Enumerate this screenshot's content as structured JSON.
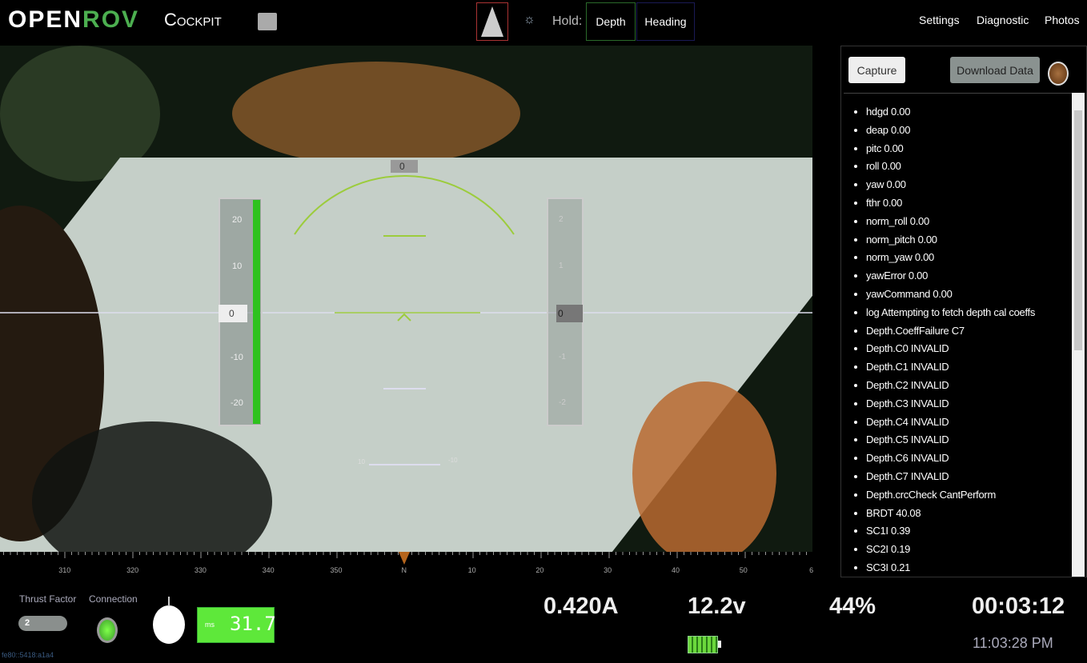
{
  "header": {
    "logo": "OPENROV",
    "logo_a": "OPEN",
    "logo_b": "ROV",
    "app": "Cockpit",
    "hold_label": "Hold:",
    "hold_depth": "Depth",
    "hold_heading": "Heading",
    "nav": [
      "Settings",
      "Diagnostic",
      "Photos"
    ]
  },
  "hud": {
    "heading_value": "0",
    "depth_value": "0",
    "pitch_value": "0",
    "depth_ticks": [
      "20",
      "10",
      "-10",
      "-20"
    ],
    "pitch_ticks": [
      "2",
      "1",
      "-1",
      "-2"
    ],
    "roll_left": "10",
    "roll_right": "-10"
  },
  "compass": {
    "labels": [
      "0",
      "310",
      "320",
      "330",
      "340",
      "350",
      "N",
      "10",
      "20",
      "30",
      "40",
      "50",
      "6"
    ]
  },
  "panel": {
    "capture": "Capture",
    "download": "Download Data",
    "log": [
      "hdgd 0.00",
      "deap 0.00",
      "pitc 0.00",
      "roll 0.00",
      "yaw 0.00",
      "fthr 0.00",
      "norm_roll 0.00",
      "norm_pitch 0.00",
      "norm_yaw 0.00",
      "yawError 0.00",
      "yawCommand 0.00",
      "log Attempting to fetch depth cal coeffs",
      "Depth.CoeffFailure C7",
      "Depth.C0 INVALID",
      "Depth.C1 INVALID",
      "Depth.C2 INVALID",
      "Depth.C3 INVALID",
      "Depth.C4 INVALID",
      "Depth.C5 INVALID",
      "Depth.C6 INVALID",
      "Depth.C7 INVALID",
      "Depth.crcCheck CantPerform",
      "BRDT 40.08",
      "SC1I 0.39",
      "SC2I 0.19",
      "SC3I 0.21"
    ]
  },
  "status": {
    "thrust_label": "Thrust Factor",
    "thrust_value": "2",
    "connection_label": "Connection",
    "latency_unit": "ms",
    "latency": "31.7",
    "current": "0.420A",
    "voltage": "12.2v",
    "percent": "44%",
    "elapsed": "00:03:12",
    "clock": "11:03:28 PM",
    "ip": "fe80::5418:a1a4"
  },
  "colors": {
    "accent": "#4caf50",
    "hud": "#9ccc3c"
  }
}
